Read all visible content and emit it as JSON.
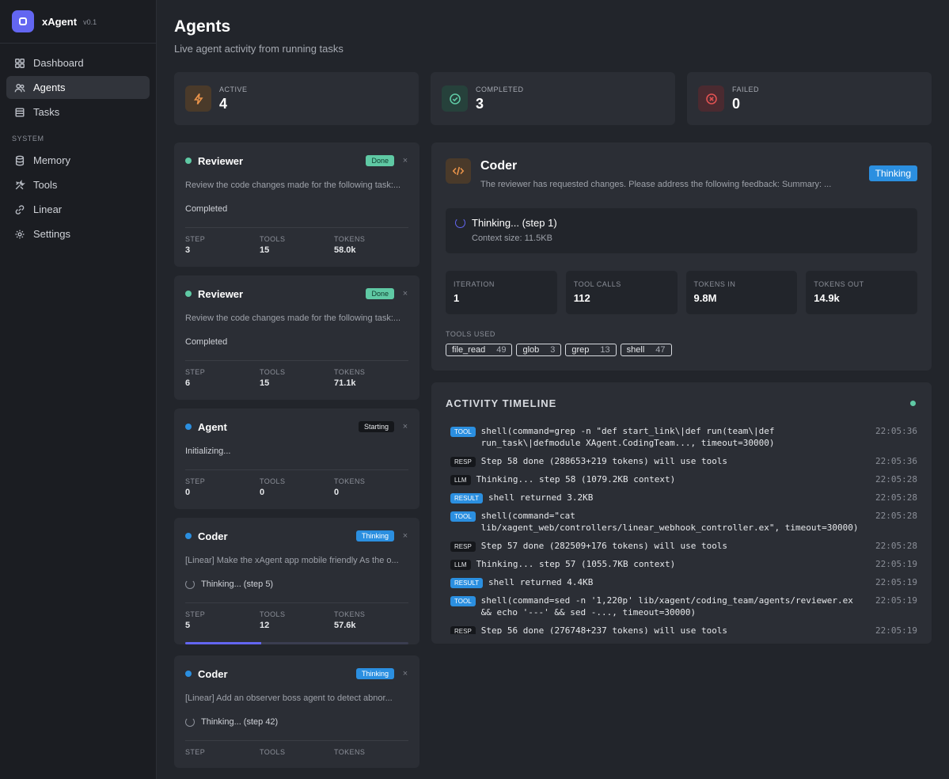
{
  "brand": {
    "name": "xAgent",
    "version": "v0.1"
  },
  "nav": {
    "items": [
      {
        "label": "Dashboard"
      },
      {
        "label": "Agents"
      },
      {
        "label": "Tasks"
      }
    ],
    "section": "SYSTEM",
    "system_items": [
      {
        "label": "Memory"
      },
      {
        "label": "Tools"
      },
      {
        "label": "Linear"
      },
      {
        "label": "Settings"
      }
    ]
  },
  "page": {
    "title": "Agents",
    "subtitle": "Live agent activity from running tasks"
  },
  "stats": [
    {
      "label": "ACTIVE",
      "value": "4",
      "color": "#e9934a"
    },
    {
      "label": "COMPLETED",
      "value": "3",
      "color": "#5fc9a4"
    },
    {
      "label": "FAILED",
      "value": "0",
      "color": "#e05252"
    }
  ],
  "metric_labels": {
    "step": "STEP",
    "tools": "TOOLS",
    "tokens": "TOKENS"
  },
  "agents": [
    {
      "name": "Reviewer",
      "badge": "Done",
      "desc": "Review the code changes made for the following task:...",
      "status": "Completed",
      "step": "3",
      "tools": "15",
      "tokens": "58.0k",
      "dot_color": "#5fc9a4"
    },
    {
      "name": "Reviewer",
      "badge": "Done",
      "desc": "Review the code changes made for the following task:...",
      "status": "Completed",
      "step": "6",
      "tools": "15",
      "tokens": "71.1k",
      "dot_color": "#5fc9a4"
    },
    {
      "name": "Agent",
      "badge": "Starting",
      "desc": "Initializing...",
      "step": "0",
      "tools": "0",
      "tokens": "0",
      "dot_color": "#2b8fe0"
    },
    {
      "name": "Coder",
      "badge": "Thinking",
      "desc": "[Linear] Make the xAgent app mobile friendly As the o...",
      "status": "Thinking... (step 5)",
      "step": "5",
      "tools": "12",
      "tokens": "57.6k",
      "progress": 0.34,
      "dot_color": "#2b8fe0"
    },
    {
      "name": "Coder",
      "badge": "Thinking",
      "desc": "[Linear] Add an observer boss agent to detect abnor...",
      "status": "Thinking... (step 42)",
      "dot_color": "#2b8fe0"
    }
  ],
  "detail": {
    "name": "Coder",
    "desc": "The reviewer has requested changes. Please address the following feedback: Summary: ...",
    "badge": "Thinking",
    "thinking": "Thinking... (step 1)",
    "context": "Context size: 11.5KB",
    "metrics": [
      {
        "label": "ITERATION",
        "value": "1"
      },
      {
        "label": "TOOL CALLS",
        "value": "112"
      },
      {
        "label": "TOKENS IN",
        "value": "9.8M"
      },
      {
        "label": "TOKENS OUT",
        "value": "14.9k"
      }
    ],
    "tools_label": "TOOLS USED",
    "tools": [
      {
        "name": "file_read",
        "count": "49"
      },
      {
        "name": "glob",
        "count": "3"
      },
      {
        "name": "grep",
        "count": "13"
      },
      {
        "name": "shell",
        "count": "47"
      }
    ]
  },
  "timeline": {
    "title": "ACTIVITY TIMELINE",
    "rows": [
      {
        "tag": "TOOL",
        "type": "tool",
        "text": "shell(command=grep -n \"def start_link\\|def run(team\\|def\nrun_task\\|defmodule XAgent.CodingTeam..., timeout=30000)",
        "time": "22:05:36"
      },
      {
        "tag": "RESP",
        "type": "resp",
        "text": "Step 58 done (288653+219 tokens) will use tools",
        "time": "22:05:36"
      },
      {
        "tag": "LLM",
        "type": "llm",
        "text": "Thinking... step 58 (1079.2KB context)",
        "time": "22:05:28"
      },
      {
        "tag": "RESULT",
        "type": "result",
        "text": "shell returned 3.2KB",
        "time": "22:05:28"
      },
      {
        "tag": "TOOL",
        "type": "tool",
        "text": "shell(command=\"cat\nlib/xagent_web/controllers/linear_webhook_controller.ex\", timeout=30000)",
        "time": "22:05:28"
      },
      {
        "tag": "RESP",
        "type": "resp",
        "text": "Step 57 done (282509+176 tokens) will use tools",
        "time": "22:05:28"
      },
      {
        "tag": "LLM",
        "type": "llm",
        "text": "Thinking... step 57 (1055.7KB context)",
        "time": "22:05:19"
      },
      {
        "tag": "RESULT",
        "type": "result",
        "text": "shell returned 4.4KB",
        "time": "22:05:19"
      },
      {
        "tag": "TOOL",
        "type": "tool",
        "text": "shell(command=sed -n '1,220p' lib/xagent/coding_team/agents/reviewer.ex\n&& echo '---' && sed -..., timeout=30000)",
        "time": "22:05:19"
      },
      {
        "tag": "RESP",
        "type": "resp",
        "text": "Step 56 done (276748+237 tokens) will use tools",
        "time": "22:05:19"
      }
    ]
  }
}
